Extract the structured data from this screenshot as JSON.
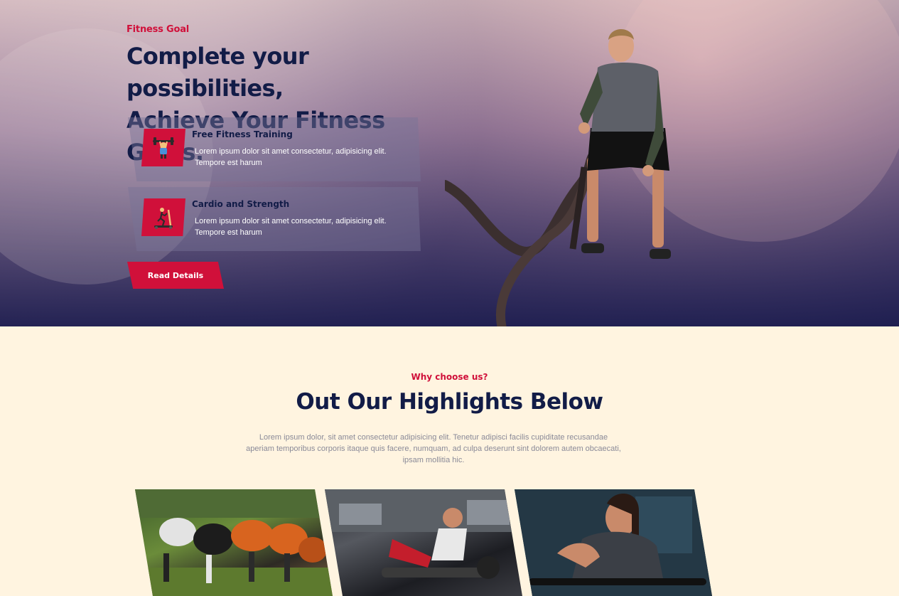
{
  "hero": {
    "eyebrow": "Fitness Goal",
    "title_line1": "Complete your possibilities,",
    "title_line2": "Achieve Your Fitness Goals.",
    "features": [
      {
        "icon": "weightlifting-icon",
        "title": "Free Fitness Training",
        "text": "Lorem ipsum dolor sit amet consectetur, adipisicing elit. Tempore est harum"
      },
      {
        "icon": "treadmill-icon",
        "title": "Cardio and Strength",
        "text": "Lorem ipsum dolor sit amet consectetur, adipisicing elit. Tempore est harum"
      }
    ],
    "button_label": "Read Details"
  },
  "highlights": {
    "eyebrow": "Why choose us?",
    "title": "Out Our Highlights Below",
    "description": "Lorem ipsum dolor, sit amet consectetur adipisicing elit. Tenetur adipisci facilis cupiditate recusandae aperiam temporibus corporis itaque quis facere, numquam, ad culpa deserunt sint dolorem autem obcaecati, ipsam mollitia hic."
  },
  "colors": {
    "accent": "#d0103a",
    "heading": "#121c47",
    "section_bg": "#fff4e0"
  }
}
